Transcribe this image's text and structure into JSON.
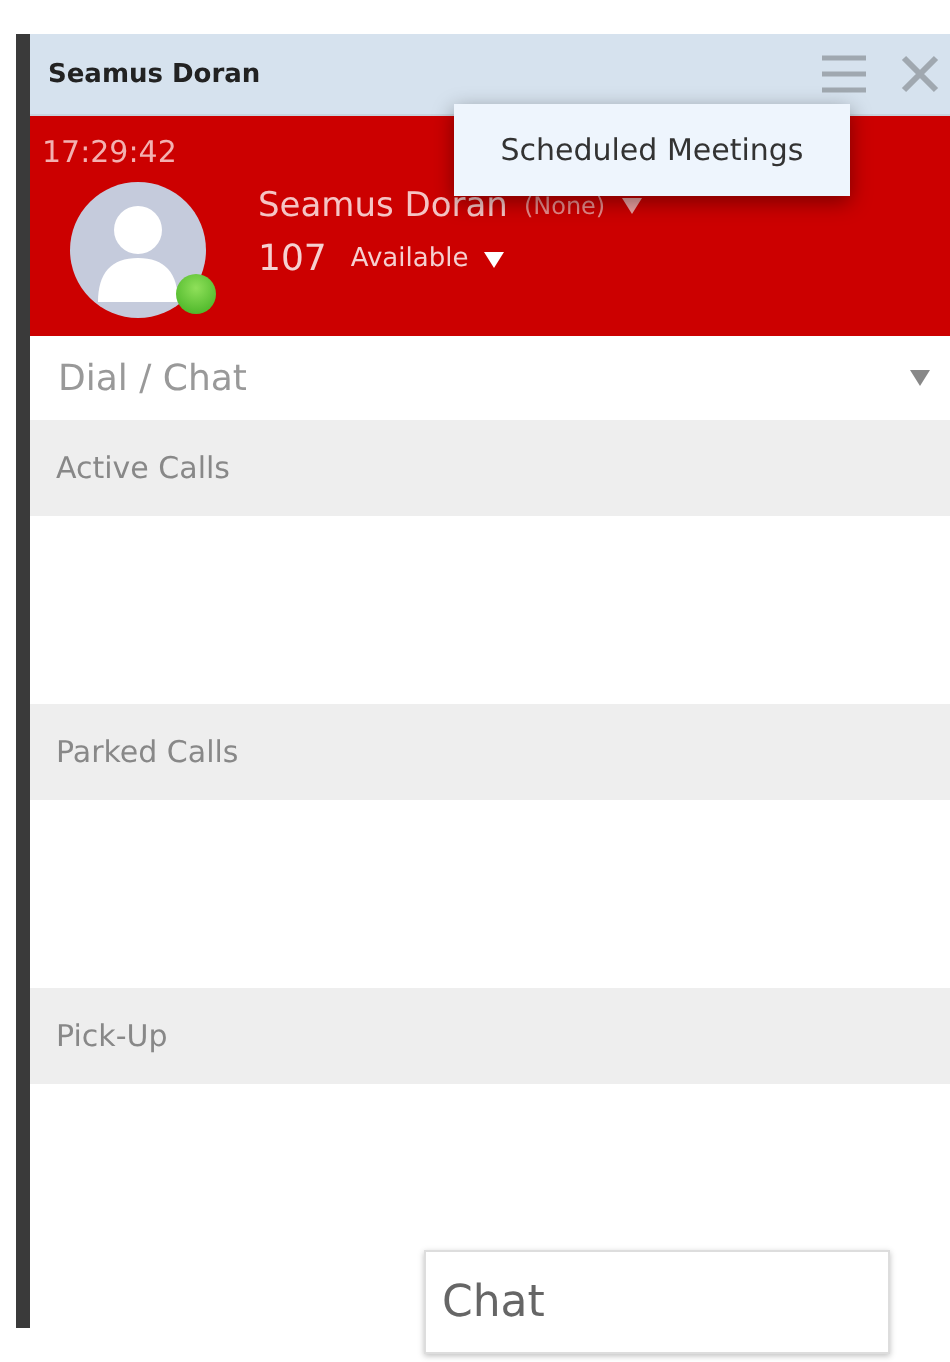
{
  "window": {
    "title": "Seamus Doran"
  },
  "header": {
    "time": "17:29:42",
    "name": "Seamus Doran",
    "role": "(None)",
    "extension": "107",
    "status": "Available"
  },
  "dial_field": {
    "placeholder": "Dial / Chat"
  },
  "sections": [
    {
      "label": "Active Calls"
    },
    {
      "label": "Parked Calls"
    },
    {
      "label": "Pick-Up"
    }
  ],
  "menu": {
    "items": [
      "Scheduled Meetings"
    ]
  },
  "chat_field": {
    "placeholder": "Chat"
  }
}
